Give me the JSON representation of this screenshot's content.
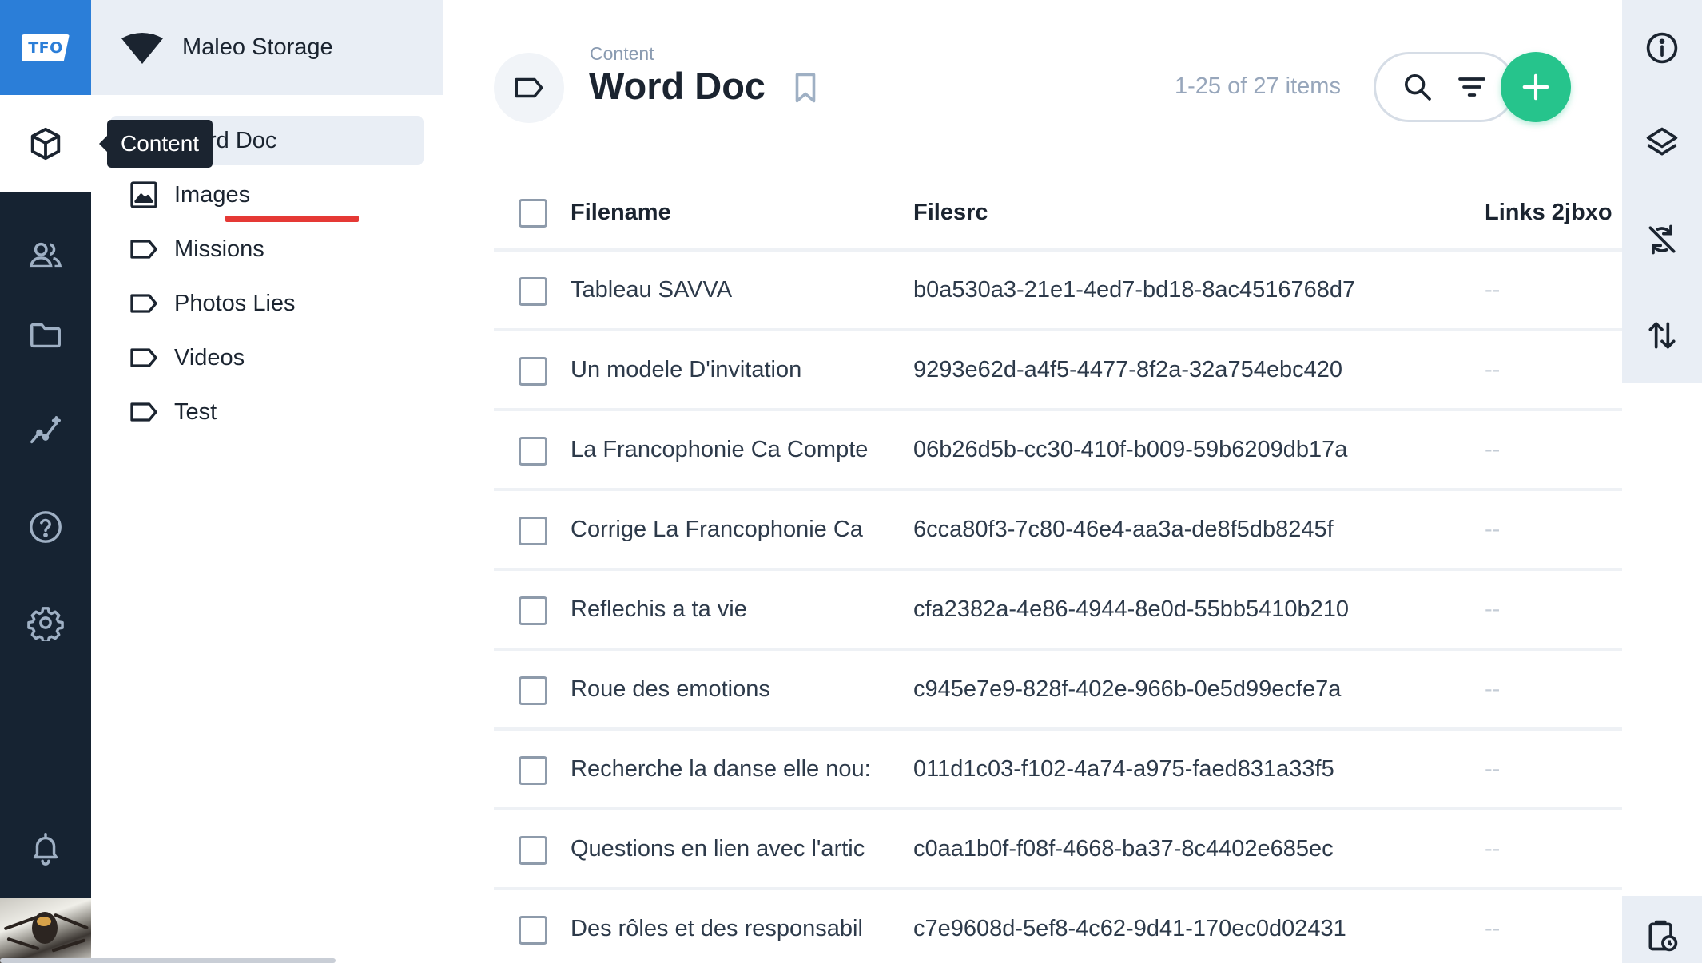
{
  "brand": {
    "logo_text": "TFO",
    "logo_color": "#2b7ed8"
  },
  "rail": {
    "items": [
      {
        "icon": "cube-icon",
        "active": true
      },
      {
        "icon": "users-icon"
      },
      {
        "icon": "folder-icon"
      },
      {
        "icon": "analytics-icon"
      },
      {
        "icon": "help-icon"
      },
      {
        "icon": "settings-icon"
      },
      {
        "icon": "bell-icon"
      }
    ],
    "tooltip": "Content"
  },
  "sidebar": {
    "workspace": "Maleo Storage",
    "items": [
      {
        "label": "Word Doc",
        "icon": "tag-icon",
        "selected": true
      },
      {
        "label": "Images",
        "icon": "image-icon"
      },
      {
        "label": "Missions",
        "icon": "tag-icon"
      },
      {
        "label": "Photos Lies",
        "icon": "tag-icon"
      },
      {
        "label": "Videos",
        "icon": "tag-icon"
      },
      {
        "label": "Test",
        "icon": "tag-icon"
      }
    ]
  },
  "header": {
    "breadcrumb": "Content",
    "title": "Word Doc",
    "count": "1-25 of 27 items",
    "accent": "#26c48c"
  },
  "table": {
    "columns": [
      "Filename",
      "Filesrc",
      "Links 2jbxo"
    ],
    "rows": [
      {
        "filename": "Tableau SAVVA",
        "filesrc": "b0a530a3-21e1-4ed7-bd18-8ac4516768d7",
        "links": "--"
      },
      {
        "filename": "Un modele D'invitation",
        "filesrc": "9293e62d-a4f5-4477-8f2a-32a754ebc420",
        "links": "--"
      },
      {
        "filename": "La Francophonie Ca Compte",
        "filesrc": "06b26d5b-cc30-410f-b009-59b6209db17a",
        "links": "--"
      },
      {
        "filename": "Corrige La Francophonie Ca",
        "filesrc": "6cca80f3-7c80-46e4-aa3a-de8f5db8245f",
        "links": "--"
      },
      {
        "filename": "Reflechis a ta vie",
        "filesrc": "cfa2382a-4e86-4944-8e0d-55bb5410b210",
        "links": "--"
      },
      {
        "filename": "Roue des emotions",
        "filesrc": "c945e7e9-828f-402e-966b-0e5d99ecfe7a",
        "links": "--"
      },
      {
        "filename": "Recherche la danse elle nou:",
        "filesrc": "011d1c03-f102-4a74-a975-faed831a33f5",
        "links": "--"
      },
      {
        "filename": "Questions en lien avec l'artic",
        "filesrc": "c0aa1b0f-f08f-4668-ba37-8c4402e685ec",
        "links": "--"
      },
      {
        "filename": "Des rôles et des responsabil",
        "filesrc": "c7e9608d-5ef8-4c62-9d41-170ec0d02431",
        "links": "--"
      }
    ]
  },
  "right_rail": {
    "items": [
      {
        "icon": "info-icon"
      },
      {
        "icon": "layers-icon"
      },
      {
        "icon": "sync-disabled-icon"
      },
      {
        "icon": "sort-arrows-icon"
      },
      {
        "icon": "clipboard-clock-icon"
      }
    ]
  }
}
